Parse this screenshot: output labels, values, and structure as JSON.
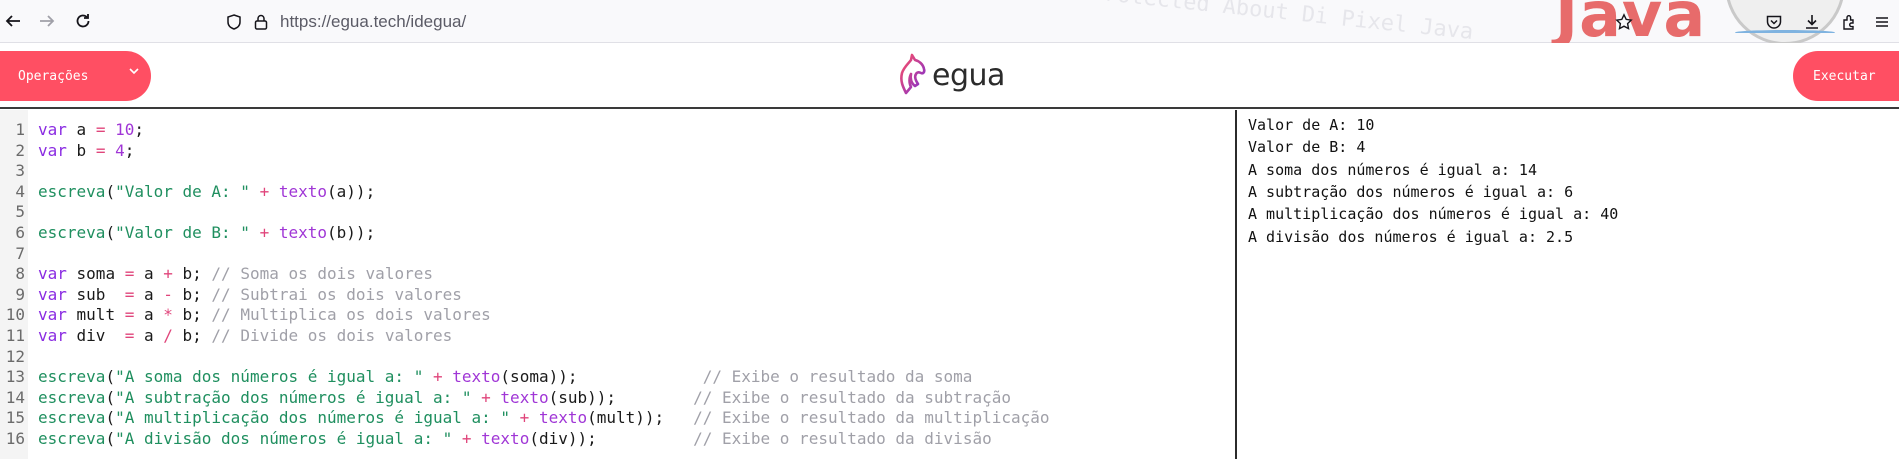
{
  "browser": {
    "url_host": "https://egua.tech",
    "url_path": "/idegua/"
  },
  "background": {
    "deco_text": "Protected  About  Di    Pixel    Java",
    "java_logo": "Java"
  },
  "header": {
    "operations_label": "Operações",
    "logo_text": "egua",
    "run_label": "Executar"
  },
  "colors": {
    "accent": "#ff4f63",
    "keyword": "#8a2be2",
    "string": "#1f8f5f",
    "comment": "#a0a0a8"
  },
  "editor": {
    "lines": [
      {
        "n": "1",
        "tokens": [
          [
            "kw",
            "var"
          ],
          [
            "t",
            " a "
          ],
          [
            "op",
            "="
          ],
          [
            "t",
            " "
          ],
          [
            "num",
            "10"
          ],
          [
            "t",
            ";"
          ]
        ]
      },
      {
        "n": "2",
        "tokens": [
          [
            "kw",
            "var"
          ],
          [
            "t",
            " b "
          ],
          [
            "op",
            "="
          ],
          [
            "t",
            " "
          ],
          [
            "num",
            "4"
          ],
          [
            "t",
            ";"
          ]
        ]
      },
      {
        "n": "3",
        "tokens": []
      },
      {
        "n": "4",
        "tokens": [
          [
            "fnc",
            "escreva"
          ],
          [
            "t",
            "("
          ],
          [
            "str",
            "\"Valor de A: \""
          ],
          [
            "t",
            " "
          ],
          [
            "op",
            "+"
          ],
          [
            "t",
            " "
          ],
          [
            "fn",
            "texto"
          ],
          [
            "t",
            "(a));"
          ]
        ]
      },
      {
        "n": "5",
        "tokens": []
      },
      {
        "n": "6",
        "tokens": [
          [
            "fnc",
            "escreva"
          ],
          [
            "t",
            "("
          ],
          [
            "str",
            "\"Valor de B: \""
          ],
          [
            "t",
            " "
          ],
          [
            "op",
            "+"
          ],
          [
            "t",
            " "
          ],
          [
            "fn",
            "texto"
          ],
          [
            "t",
            "(b));"
          ]
        ]
      },
      {
        "n": "7",
        "tokens": []
      },
      {
        "n": "8",
        "tokens": [
          [
            "kw",
            "var"
          ],
          [
            "t",
            " soma "
          ],
          [
            "op",
            "="
          ],
          [
            "t",
            " a "
          ],
          [
            "op",
            "+"
          ],
          [
            "t",
            " b; "
          ],
          [
            "cm",
            "// Soma os dois valores"
          ]
        ]
      },
      {
        "n": "9",
        "tokens": [
          [
            "kw",
            "var"
          ],
          [
            "t",
            " sub  "
          ],
          [
            "op",
            "="
          ],
          [
            "t",
            " a "
          ],
          [
            "op",
            "-"
          ],
          [
            "t",
            " b; "
          ],
          [
            "cm",
            "// Subtrai os dois valores"
          ]
        ]
      },
      {
        "n": "10",
        "tokens": [
          [
            "kw",
            "var"
          ],
          [
            "t",
            " mult "
          ],
          [
            "op",
            "="
          ],
          [
            "t",
            " a "
          ],
          [
            "op",
            "*"
          ],
          [
            "t",
            " b; "
          ],
          [
            "cm",
            "// Multiplica os dois valores"
          ]
        ]
      },
      {
        "n": "11",
        "tokens": [
          [
            "kw",
            "var"
          ],
          [
            "t",
            " div  "
          ],
          [
            "op",
            "="
          ],
          [
            "t",
            " a "
          ],
          [
            "op",
            "/"
          ],
          [
            "t",
            " b; "
          ],
          [
            "cm",
            "// Divide os dois valores"
          ]
        ]
      },
      {
        "n": "12",
        "tokens": []
      },
      {
        "n": "13",
        "tokens": [
          [
            "fnc",
            "escreva"
          ],
          [
            "t",
            "("
          ],
          [
            "str",
            "\"A soma dos números é igual a: \""
          ],
          [
            "t",
            " "
          ],
          [
            "op",
            "+"
          ],
          [
            "t",
            " "
          ],
          [
            "fn",
            "texto"
          ],
          [
            "t",
            "(soma));             "
          ],
          [
            "cm",
            "// Exibe o resultado da soma"
          ]
        ]
      },
      {
        "n": "14",
        "tokens": [
          [
            "fnc",
            "escreva"
          ],
          [
            "t",
            "("
          ],
          [
            "str",
            "\"A subtração dos números é igual a: \""
          ],
          [
            "t",
            " "
          ],
          [
            "op",
            "+"
          ],
          [
            "t",
            " "
          ],
          [
            "fn",
            "texto"
          ],
          [
            "t",
            "(sub));        "
          ],
          [
            "cm",
            "// Exibe o resultado da subtração"
          ]
        ]
      },
      {
        "n": "15",
        "tokens": [
          [
            "fnc",
            "escreva"
          ],
          [
            "t",
            "("
          ],
          [
            "str",
            "\"A multiplicação dos números é igual a: \""
          ],
          [
            "t",
            " "
          ],
          [
            "op",
            "+"
          ],
          [
            "t",
            " "
          ],
          [
            "fn",
            "texto"
          ],
          [
            "t",
            "(mult));   "
          ],
          [
            "cm",
            "// Exibe o resultado da multiplicação"
          ]
        ]
      },
      {
        "n": "16",
        "tokens": [
          [
            "fnc",
            "escreva"
          ],
          [
            "t",
            "("
          ],
          [
            "str",
            "\"A divisão dos números é igual a: \""
          ],
          [
            "t",
            " "
          ],
          [
            "op",
            "+"
          ],
          [
            "t",
            " "
          ],
          [
            "fn",
            "texto"
          ],
          [
            "t",
            "(div));          "
          ],
          [
            "cm",
            "// Exibe o resultado da divisão"
          ]
        ]
      }
    ]
  },
  "output": {
    "lines": [
      "Valor de A: 10",
      "Valor de B: 4",
      "A soma dos números é igual a: 14",
      "A subtração dos números é igual a: 6",
      "A multiplicação dos números é igual a: 40",
      "A divisão dos números é igual a: 2.5"
    ]
  }
}
